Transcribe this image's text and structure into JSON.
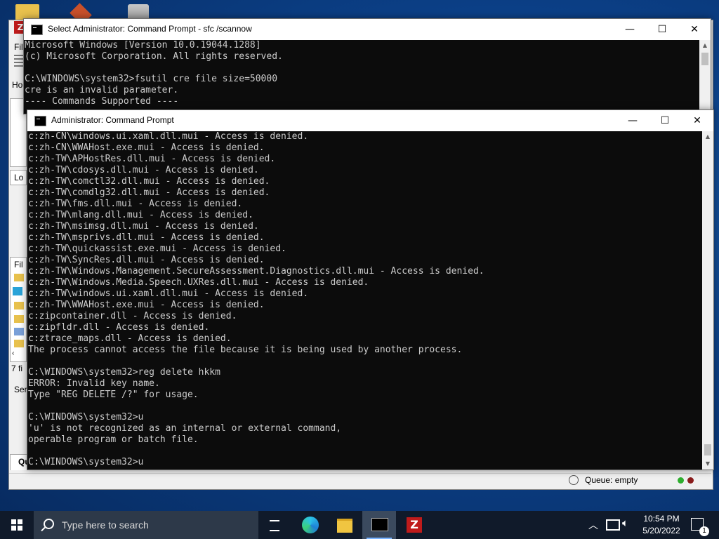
{
  "fz_fragments": {
    "menu_file": "Fil",
    "home": "Ho",
    "local": "Lo",
    "files_label": "Fil",
    "file_count": "7 fi",
    "server": "Ser",
    "queue_tab": "Qu"
  },
  "back_window": {
    "title": "Select Administrator: Command Prompt - sfc  /scannow",
    "lines": [
      "Microsoft Windows [Version 10.0.19044.1288]",
      "(c) Microsoft Corporation. All rights reserved.",
      "",
      "C:\\WINDOWS\\system32>fsutil cre file size=50000",
      "cre is an invalid parameter.",
      "---- Commands Supported ----"
    ]
  },
  "front_window": {
    "title": "Administrator: Command Prompt",
    "lines": [
      "c:zh-CN\\windows.ui.xaml.dll.mui - Access is denied.",
      "c:zh-CN\\WWAHost.exe.mui - Access is denied.",
      "c:zh-TW\\APHostRes.dll.mui - Access is denied.",
      "c:zh-TW\\cdosys.dll.mui - Access is denied.",
      "c:zh-TW\\comctl32.dll.mui - Access is denied.",
      "c:zh-TW\\comdlg32.dll.mui - Access is denied.",
      "c:zh-TW\\fms.dll.mui - Access is denied.",
      "c:zh-TW\\mlang.dll.mui - Access is denied.",
      "c:zh-TW\\msimsg.dll.mui - Access is denied.",
      "c:zh-TW\\msprivs.dll.mui - Access is denied.",
      "c:zh-TW\\quickassist.exe.mui - Access is denied.",
      "c:zh-TW\\SyncRes.dll.mui - Access is denied.",
      "c:zh-TW\\Windows.Management.SecureAssessment.Diagnostics.dll.mui - Access is denied.",
      "c:zh-TW\\Windows.Media.Speech.UXRes.dll.mui - Access is denied.",
      "c:zh-TW\\windows.ui.xaml.dll.mui - Access is denied.",
      "c:zh-TW\\WWAHost.exe.mui - Access is denied.",
      "c:zipcontainer.dll - Access is denied.",
      "c:zipfldr.dll - Access is denied.",
      "c:ztrace_maps.dll - Access is denied.",
      "The process cannot access the file because it is being used by another process.",
      "",
      "C:\\WINDOWS\\system32>reg delete hkkm",
      "ERROR: Invalid key name.",
      "Type \"REG DELETE /?\" for usage.",
      "",
      "C:\\WINDOWS\\system32>u",
      "'u' is not recognized as an internal or external command,",
      "operable program or batch file.",
      "",
      "C:\\WINDOWS\\system32>u"
    ]
  },
  "window_controls": {
    "minimize": "—",
    "maximize": "☐",
    "close": "✕"
  },
  "fz_status": {
    "queue": "Queue: empty"
  },
  "taskbar": {
    "search_placeholder": "Type here to search",
    "time": "10:54 PM",
    "date": "5/20/2022",
    "notification_count": "1"
  },
  "colors": {
    "console_bg": "#0c0c0c",
    "console_text": "#cccccc",
    "taskbar_bg": "#101a2a",
    "filezilla_red": "#bf1b1b"
  }
}
